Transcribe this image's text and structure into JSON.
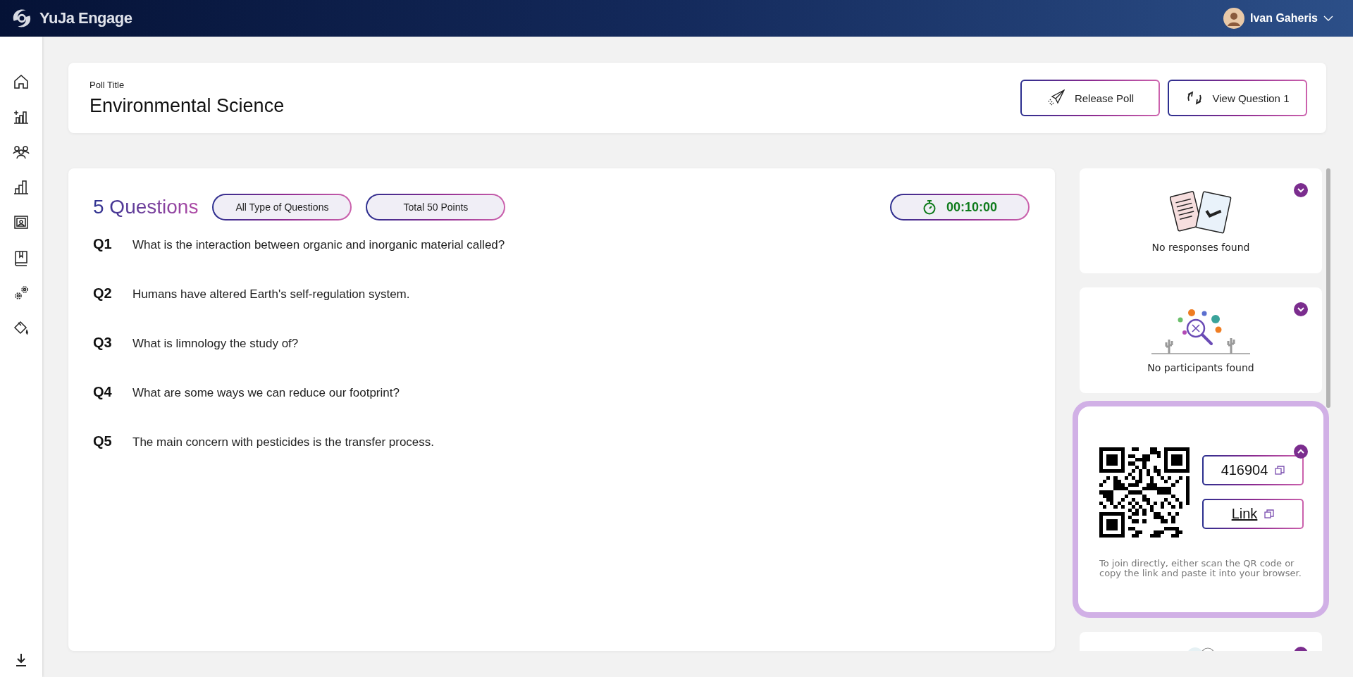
{
  "app": {
    "name": "YuJa Engage"
  },
  "user": {
    "name": "Ivan Gaheris"
  },
  "poll": {
    "label": "Poll Title",
    "title": "Environmental Science"
  },
  "actions": [
    {
      "kind": "release",
      "label": "Release Poll"
    },
    {
      "kind": "view",
      "label": "View Question 1"
    }
  ],
  "questions_panel": {
    "count": "5 Questions",
    "filters": [
      "All Type of Questions",
      "Total 50 Points"
    ],
    "timer": "00:10:00",
    "questions": [
      {
        "number": "Q1",
        "text": "What is the interaction between organic and inorganic material called?"
      },
      {
        "number": "Q2",
        "text": "Humans have altered Earth's self-regulation system."
      },
      {
        "number": "Q3",
        "text": "What is limnology the study of?"
      },
      {
        "number": "Q4",
        "text": "What are some ways we can reduce our footprint?"
      },
      {
        "number": "Q5",
        "text": "The main concern with pesticides is the transfer process."
      }
    ]
  },
  "side_cards": [
    {
      "kind": "responses",
      "expanded": false,
      "message": "No responses found"
    },
    {
      "kind": "participants",
      "expanded": false,
      "message": "No participants found"
    },
    {
      "kind": "join",
      "expanded": true,
      "code": "416904",
      "link_label": "Link",
      "hint": "To join directly, either scan the QR code or copy the link and paste it into your browser."
    },
    {
      "kind": "partial",
      "expanded": false
    }
  ]
}
